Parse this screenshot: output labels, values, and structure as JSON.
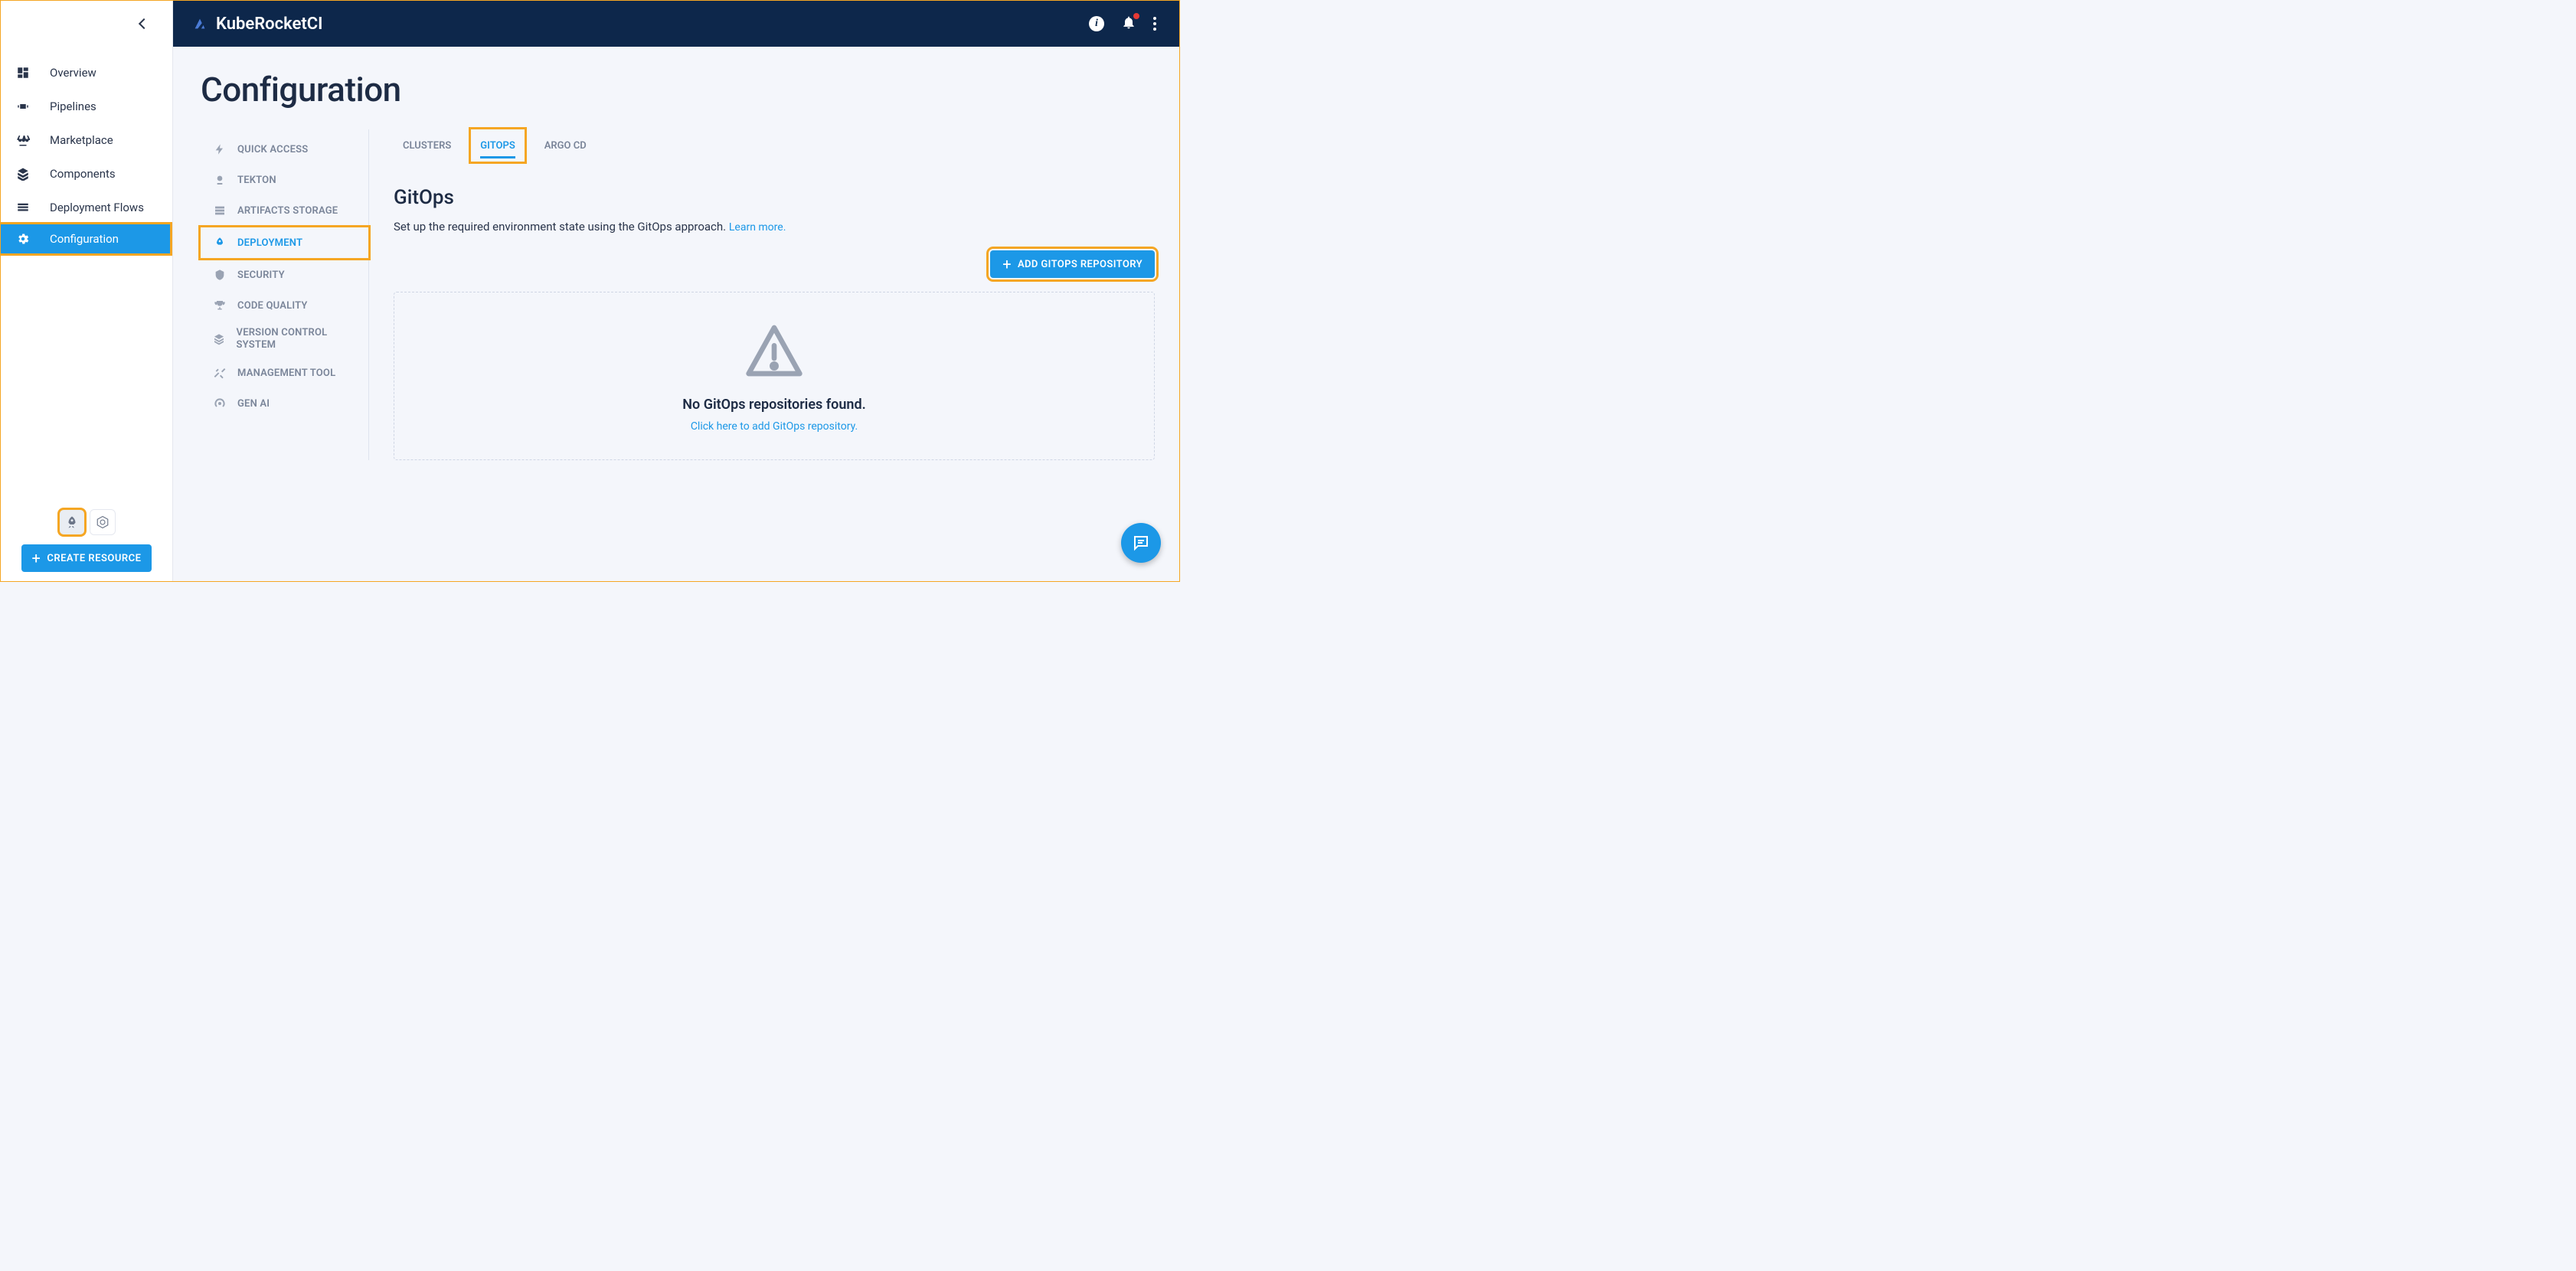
{
  "brand": "KubeRocketCI",
  "sidebar": {
    "items": [
      {
        "label": "Overview"
      },
      {
        "label": "Pipelines"
      },
      {
        "label": "Marketplace"
      },
      {
        "label": "Components"
      },
      {
        "label": "Deployment Flows"
      },
      {
        "label": "Configuration"
      }
    ],
    "create_button": "CREATE RESOURCE"
  },
  "page": {
    "title": "Configuration"
  },
  "config_menu": [
    {
      "label": "QUICK ACCESS"
    },
    {
      "label": "TEKTON"
    },
    {
      "label": "ARTIFACTS STORAGE"
    },
    {
      "label": "DEPLOYMENT"
    },
    {
      "label": "SECURITY"
    },
    {
      "label": "CODE QUALITY"
    },
    {
      "label": "VERSION CONTROL SYSTEM"
    },
    {
      "label": "MANAGEMENT TOOL"
    },
    {
      "label": "GEN AI"
    }
  ],
  "tabs": [
    {
      "label": "CLUSTERS"
    },
    {
      "label": "GITOPS"
    },
    {
      "label": "ARGO CD"
    }
  ],
  "section": {
    "title": "GitOps",
    "desc": "Set up the required environment state using the GitOps approach.",
    "learn_more": "Learn more.",
    "add_button": "ADD GITOPS REPOSITORY",
    "empty_title": "No GitOps repositories found.",
    "empty_link": "Click here to add GitOps repository."
  }
}
